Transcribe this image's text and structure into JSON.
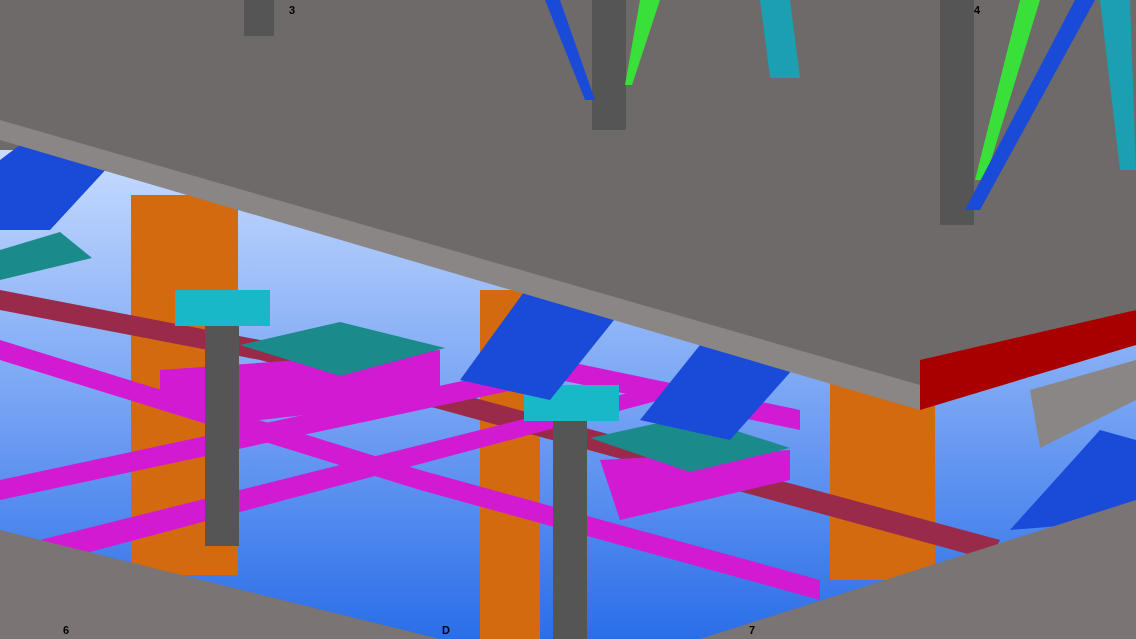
{
  "viewport": {
    "grid_labels": [
      {
        "text": "3"
      },
      {
        "text": "4"
      },
      {
        "text": "6"
      },
      {
        "text": "D"
      },
      {
        "text": "7"
      }
    ]
  }
}
